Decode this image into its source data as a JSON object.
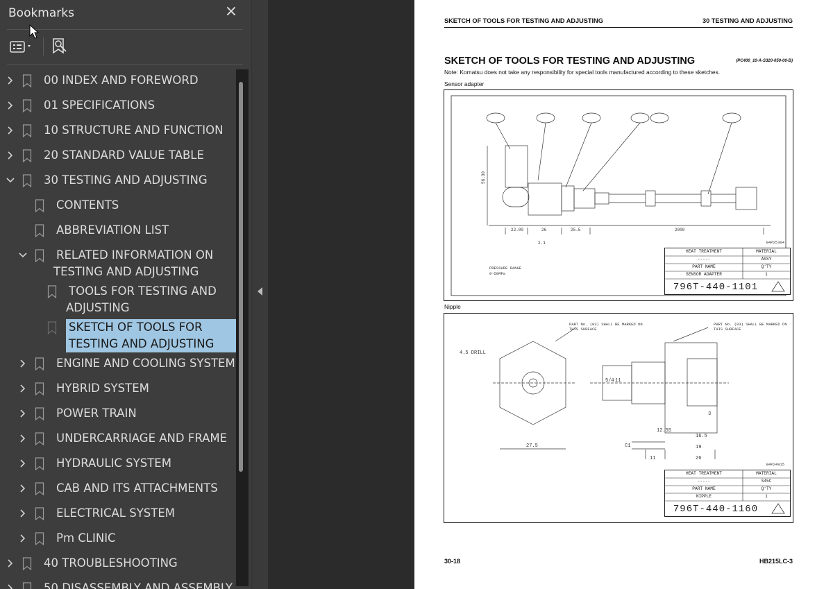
{
  "sidebar": {
    "title": "Bookmarks",
    "close_glyph": "×",
    "tree": [
      {
        "label": "00 INDEX AND FOREWORD",
        "level": 0,
        "chevron": "right"
      },
      {
        "label": "01 SPECIFICATIONS",
        "level": 0,
        "chevron": "right"
      },
      {
        "label": "10 STRUCTURE AND FUNCTION",
        "level": 0,
        "chevron": "right"
      },
      {
        "label": "20 STANDARD VALUE TABLE",
        "level": 0,
        "chevron": "right"
      },
      {
        "label": "30 TESTING AND ADJUSTING",
        "level": 0,
        "chevron": "down"
      },
      {
        "label": "CONTENTS",
        "level": 1,
        "chevron": "none"
      },
      {
        "label": "ABBREVIATION LIST",
        "level": 1,
        "chevron": "none"
      },
      {
        "label": "RELATED INFORMATION ON",
        "label2": "TESTING AND ADJUSTING",
        "level": 1,
        "chevron": "down"
      },
      {
        "label": "TOOLS FOR TESTING AND",
        "label2": "ADJUSTING",
        "level": 2,
        "chevron": "none"
      },
      {
        "label": "SKETCH OF TOOLS FOR",
        "label2": "TESTING AND ADJUSTING",
        "level": 2,
        "chevron": "none",
        "selected": true
      },
      {
        "label": "ENGINE AND COOLING SYSTEM",
        "level": 1,
        "chevron": "right"
      },
      {
        "label": "HYBRID SYSTEM",
        "level": 1,
        "chevron": "right"
      },
      {
        "label": "POWER TRAIN",
        "level": 1,
        "chevron": "right"
      },
      {
        "label": "UNDERCARRIAGE AND FRAME",
        "level": 1,
        "chevron": "right"
      },
      {
        "label": "HYDRAULIC SYSTEM",
        "level": 1,
        "chevron": "right"
      },
      {
        "label": "CAB AND ITS ATTACHMENTS",
        "level": 1,
        "chevron": "right"
      },
      {
        "label": "ELECTRICAL SYSTEM",
        "level": 1,
        "chevron": "right"
      },
      {
        "label": "Pm CLINIC",
        "level": 1,
        "chevron": "right"
      },
      {
        "label": "40 TROUBLESHOOTING",
        "level": 0,
        "chevron": "right"
      },
      {
        "label": "50 DISASSEMBLY AND ASSEMBLY",
        "level": 0,
        "chevron": "right"
      }
    ]
  },
  "page": {
    "header_left": "SKETCH OF TOOLS FOR TESTING AND ADJUSTING",
    "header_right": "30 TESTING AND ADJUSTING",
    "title": "SKETCH OF TOOLS FOR TESTING AND ADJUSTING",
    "code": "(PC400_10-A-S320-050-00-B)",
    "note": "Note: Komatsu does not take any responsibility for special tools manufactured according to these sketches.",
    "caption1": "Sensor adapter",
    "caption2": "Nipple",
    "footer_left": "30-18",
    "footer_right": "HB215LC-3",
    "fig1": {
      "ref": "84P25304",
      "pressure_range": "PRESSURE RANGE",
      "pressure_value": "0~50MPa",
      "heat_treatment": "HEAT TREATMENT",
      "heat_value": "-----",
      "material": "MATERIAL",
      "material_value": "ASSY",
      "part_name": "PART NAME",
      "part_value": "SENSOR ADAPTER",
      "qty": "Q'TY",
      "qty_value": "1",
      "part_number": "796T-440-1101",
      "dims": [
        "56.30",
        "22.00",
        "26",
        "25.5",
        "2000",
        "2.1"
      ]
    },
    "fig2": {
      "ref": "84P24915",
      "heat_treatment": "HEAT TREATMENT",
      "heat_value": "-----",
      "material": "MATERIAL",
      "material_value": "S45C",
      "part_name": "PART NAME",
      "part_value": "NIPPLE",
      "qty": "Q'TY",
      "qty_value": "1",
      "part_number": "796T-440-1160",
      "drill": "4.5 DRILL",
      "note_a": "PART No. (03) SHALL BE MARKED ON THIS SURFACE",
      "dims": [
        "27.5",
        "C1",
        "11",
        "26",
        "19",
        "16.5",
        "12.5S",
        "5/4",
        "11",
        "3"
      ]
    }
  },
  "colors": {
    "selected_bg": "#9fc6e2",
    "sidebar_bg": "#3d3d3d",
    "canvas_bg": "#2b2b2b"
  }
}
